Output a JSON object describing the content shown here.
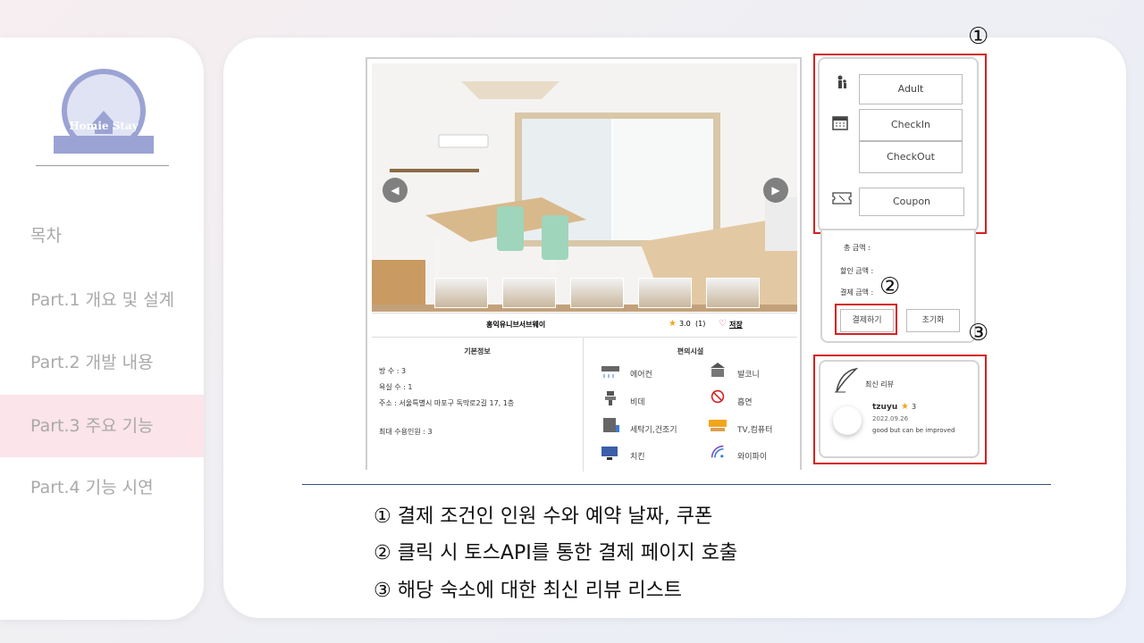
{
  "sidebar": {
    "logo_text": "Homie Stay",
    "items": [
      {
        "label": "목차"
      },
      {
        "label": "Part.1 개요 및 설계"
      },
      {
        "label": "Part.2 개발 내용"
      },
      {
        "label": "Part.3 주요 기능"
      },
      {
        "label": "Part.4 기능 시연"
      }
    ]
  },
  "listing": {
    "name": "홍익유니브서브웨이",
    "rating": "3.0",
    "reviews": "(1)",
    "save_label": "저장",
    "basic_info": {
      "title": "기본정보",
      "rooms": "방 수 : 3",
      "baths": "욕실 수 : 1",
      "address": "주소 : 서울특별시 마포구 독막로2길 17, 1층",
      "max_guests": "최대 수용인원 : 3"
    },
    "amenities": {
      "title": "편의시설",
      "items": [
        "에어컨",
        "발코니",
        "비데",
        "흡연",
        "세탁기,건조기",
        "TV,컴퓨터",
        "치킨",
        "와이파이"
      ]
    }
  },
  "booking": {
    "adult": "Adult",
    "checkin": "CheckIn",
    "checkout": "CheckOut",
    "coupon": "Coupon",
    "total_label": "총 금액 :",
    "discount_label": "할인 금액 :",
    "payment_label": "결제 금액 :",
    "pay_button": "결제하기",
    "reset_button": "초기화"
  },
  "review": {
    "title": "최신 리뷰",
    "user": "tzuyu",
    "stars": "3",
    "date": "2022.09.26",
    "text": "good but can be improved"
  },
  "markers": {
    "one": "①",
    "two": "②",
    "three": "③"
  },
  "captions": [
    "① 결제 조건인 인원 수와 예약 날짜, 쿠폰",
    "② 클릭 시 토스API를 통한 결제 페이지 호출",
    "③ 해당 숙소에 대한 최신 리뷰 리스트"
  ],
  "colors": {
    "highlight": "#d62020",
    "active_nav": "#fbe4ea",
    "star": "#f2a51a"
  }
}
